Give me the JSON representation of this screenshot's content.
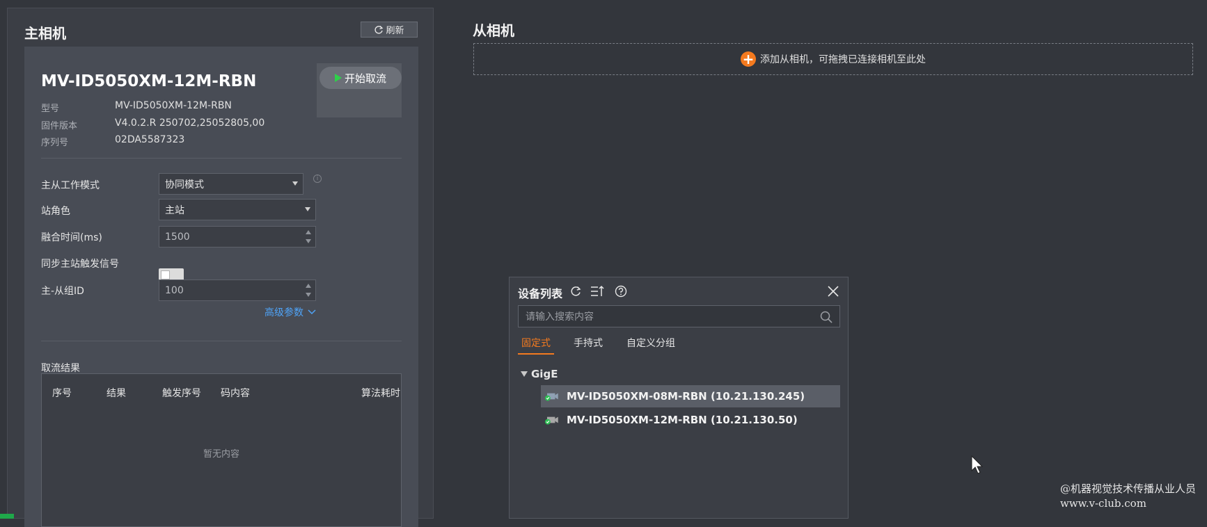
{
  "master": {
    "title": "主相机",
    "refresh_label": "刷新",
    "device_name": "MV-ID5050XM-12M-RBN",
    "start_label": "开始取流",
    "info": [
      {
        "label": "型号",
        "value": "MV-ID5050XM-12M-RBN"
      },
      {
        "label": "固件版本",
        "value": "V4.0.2.R 250702,25052805,00"
      },
      {
        "label": "序列号",
        "value": "02DA5587323"
      }
    ],
    "form": {
      "work_mode_label": "主从工作模式",
      "work_mode_value": "协同模式",
      "station_role_label": "站角色",
      "station_role_value": "主站",
      "fusion_time_label": "融合时间(ms)",
      "fusion_time_value": "1500",
      "sync_trigger_label": "同步主站触发信号",
      "sync_trigger_on": false,
      "group_id_label": "主-从组ID",
      "group_id_value": "100",
      "advanced_label": "高级参数"
    },
    "results": {
      "title": "取流结果",
      "columns": [
        "序号",
        "结果",
        "触发序号",
        "码内容",
        "算法耗时"
      ],
      "empty_text": "暂无内容"
    }
  },
  "slave": {
    "title": "从相机",
    "add_hint": "添加从相机，可拖拽已连接相机至此处"
  },
  "device_list": {
    "title": "设备列表",
    "search_placeholder": "请输入搜索内容",
    "tabs": [
      {
        "label": "固定式",
        "active": true
      },
      {
        "label": "手持式",
        "active": false
      },
      {
        "label": "自定义分组",
        "active": false
      }
    ],
    "group_name": "GigE",
    "devices": [
      {
        "label": "MV-ID5050XM-08M-RBN (10.21.130.245)",
        "selected": true
      },
      {
        "label": "MV-ID5050XM-12M-RBN (10.21.130.50)",
        "selected": false
      }
    ]
  },
  "watermark": {
    "line1": "@机器视觉技术传播从业人员",
    "line2": "www.v-club.com"
  },
  "colors": {
    "accent_orange": "#f47a1f",
    "link_blue": "#4fa3f7",
    "status_green": "#1fa84a"
  }
}
